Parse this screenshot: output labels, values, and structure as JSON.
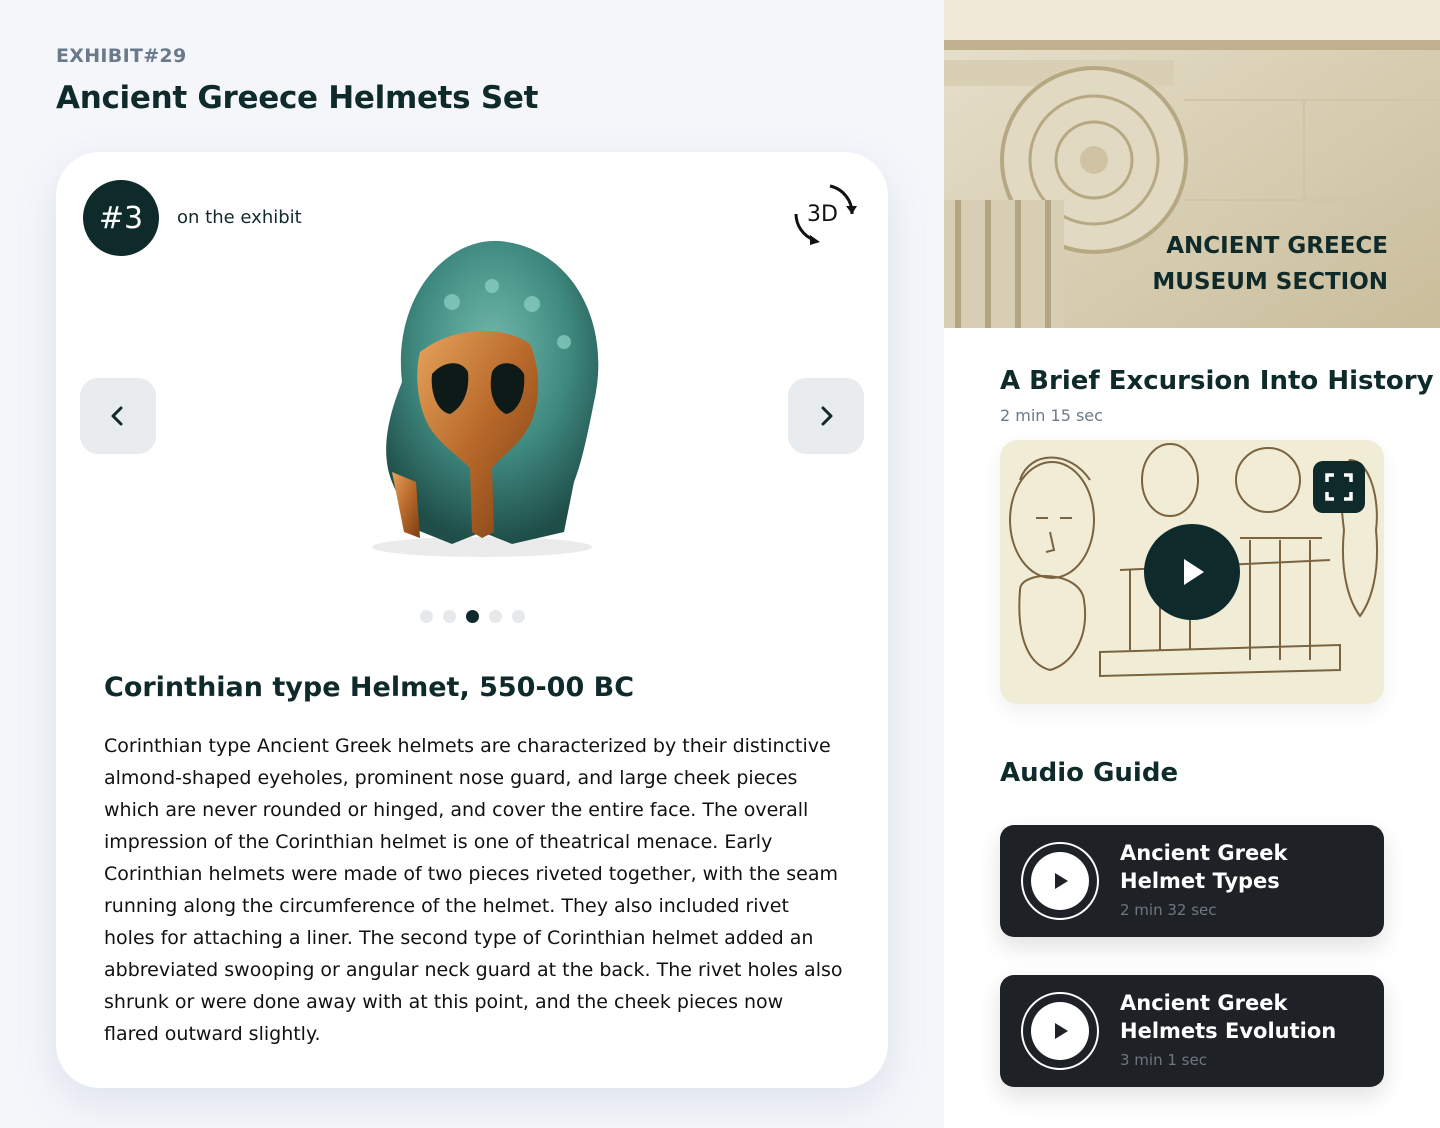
{
  "exhibit": {
    "number": "EXHIBIT#29",
    "title": "Ancient Greece Helmets Set"
  },
  "card": {
    "rank": "#3",
    "rank_caption": "on the exhibit",
    "btn_3d_label": "3D",
    "carousel": {
      "total": 5,
      "active_index": 2
    },
    "item_title": "Corinthian type Helmet, 550-00 BC",
    "item_description": "Corinthian type Ancient Greek helmets are characterized by their distinctive almond-shaped eyeholes, prominent nose guard, and large cheek pieces which are never rounded or hinged, and cover the entire face. The overall impression of the Corinthian helmet is one of theatrical menace. Early Corinthian helmets were made of two pieces riveted together, with the seam running along the circumference of the helmet. They also included rivet holes for attaching a liner. The second type of Corinthian helmet added an abbreviated swooping or angular neck guard at the back. The rivet holes also shrunk or were done away with at this point, and the cheek pieces now flared outward slightly."
  },
  "sidebar": {
    "hero_caption_line1": "ANCIENT GREECE",
    "hero_caption_line2": "MUSEUM SECTION",
    "video": {
      "title": "A Brief Excursion Into History",
      "duration": "2 min 15 sec"
    },
    "audio_guide": {
      "heading": "Audio Guide",
      "tracks": [
        {
          "title": "Ancient Greek Helmet Types",
          "duration": "2 min 32 sec"
        },
        {
          "title": "Ancient Greek Helmets Evolution",
          "duration": "3 min 1 sec"
        }
      ]
    }
  },
  "colors": {
    "primary_dark": "#0f2a2a",
    "page_background": "#f4f6fa",
    "audio_card_background": "#1e2227",
    "muted_text": "#6a7a8c"
  },
  "icons": [
    "chevron-left-icon",
    "chevron-right-icon",
    "rotate-3d-icon",
    "play-icon",
    "fullscreen-icon"
  ]
}
